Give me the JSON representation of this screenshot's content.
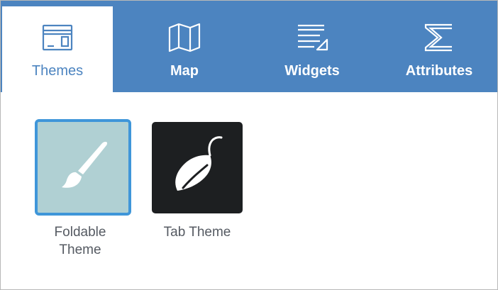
{
  "tabs": [
    {
      "label": "Themes",
      "icon": "themes-window-icon",
      "active": true
    },
    {
      "label": "Map",
      "icon": "map-icon",
      "active": false
    },
    {
      "label": "Widgets",
      "icon": "widgets-icon",
      "active": false
    },
    {
      "label": "Attributes",
      "icon": "sigma-icon",
      "active": false
    }
  ],
  "themes": [
    {
      "name_line1": "Foldable",
      "name_line2": "Theme",
      "icon": "paintbrush-icon",
      "selected": true
    },
    {
      "name": "Tab Theme",
      "icon": "leaf-icon",
      "selected": false
    }
  ],
  "colors": {
    "accent": "#4c84c0",
    "selected_border": "#3f96d9",
    "foldable_bg": "#b0d0d3",
    "tab_theme_bg": "#1d1f21"
  }
}
